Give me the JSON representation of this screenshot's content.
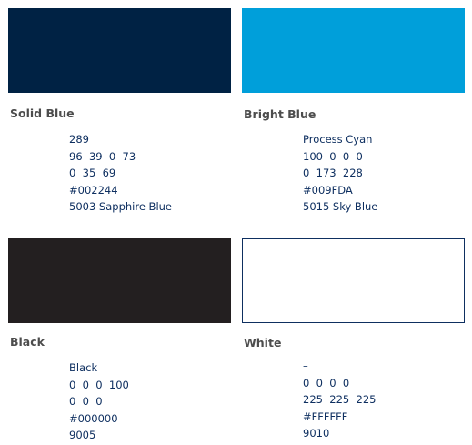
{
  "colors": [
    {
      "name": "Solid Blue",
      "swatch_color": "#002244",
      "specs": [
        "289",
        "96  39  0  73",
        "0  35  69",
        "#002244",
        "5003 Sapphire Blue"
      ]
    },
    {
      "name": "Bright Blue",
      "swatch_color": "#009FDA",
      "specs": [
        "Process Cyan",
        "100  0  0  0",
        "0  173  228",
        "#009FDA",
        "5015 Sky Blue"
      ]
    },
    {
      "name": "Black",
      "swatch_color": "#231F20",
      "specs": [
        "Black",
        "0  0  0  100",
        "0  0  0",
        "#000000",
        "9005"
      ]
    },
    {
      "name": "White",
      "swatch_color": "#FFFFFF",
      "swatch_border": "#0E2F60",
      "specs": [
        "–",
        "0  0  0  0",
        "225  225  225",
        "#FFFFFF",
        "9010"
      ]
    }
  ],
  "text_color": "#0E2F60",
  "label_color": "#4D4D4D"
}
